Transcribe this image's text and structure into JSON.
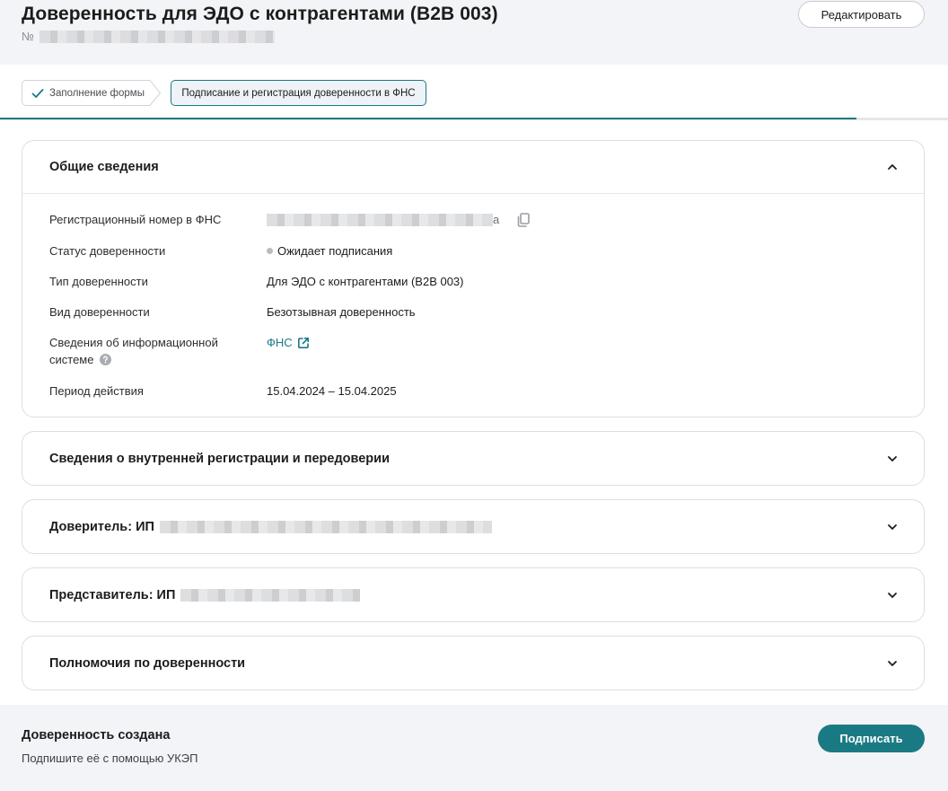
{
  "header": {
    "title": "Доверенность для ЭДО с контрагентами (B2B 003)",
    "number_prefix": "№",
    "edit_label": "Редактировать"
  },
  "stepper": {
    "steps": [
      {
        "label": "Заполнение формы",
        "state": "completed"
      },
      {
        "label": "Подписание и регистрация доверенности в ФНС",
        "state": "active"
      }
    ],
    "accent_color": "#1a7a84"
  },
  "general": {
    "title": "Общие сведения",
    "rows": [
      {
        "label": "Регистрационный номер в ФНС",
        "value_suffix": "a"
      },
      {
        "label": "Статус доверенности",
        "value": "Ожидает подписания"
      },
      {
        "label": "Тип доверенности",
        "value": "Для ЭДО с контрагентами (B2B 003)"
      },
      {
        "label": "Вид доверенности",
        "value": "Безотзывная доверенность"
      },
      {
        "label_line1": "Сведения об информационной",
        "label_line2": "системе",
        "value": "ФНС"
      },
      {
        "label": "Период действия",
        "value": "15.04.2024 – 15.04.2025"
      }
    ]
  },
  "sections": {
    "internal": "Сведения о внутренней регистрации и передоверии",
    "principal": "Доверитель: ИП",
    "representative": "Представитель: ИП",
    "powers": "Полномочия по доверенности"
  },
  "footer": {
    "title": "Доверенность создана",
    "subtitle": "Подпишите её с помощью УКЭП",
    "sign_label": "Подписать"
  }
}
